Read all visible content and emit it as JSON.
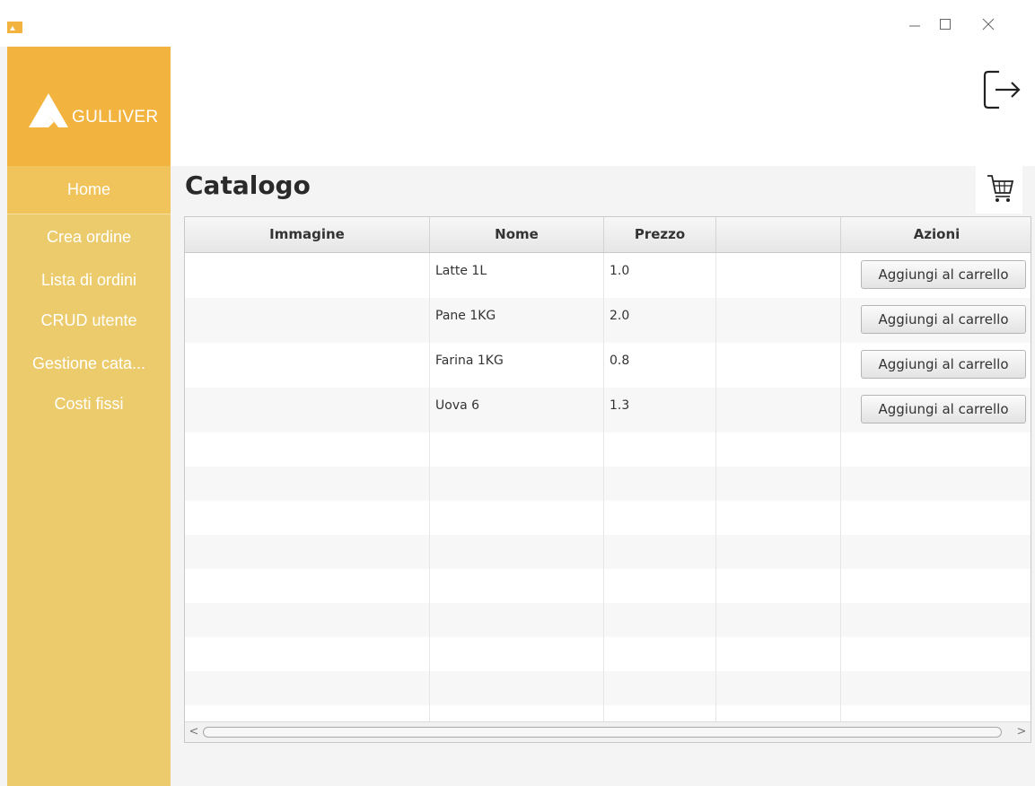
{
  "app": {
    "logo_text": "GULLIVER",
    "brand_color": "#f2b33f",
    "sidebar_color": "#ebcb6b"
  },
  "window_controls": {
    "minimize_icon": "minimize-icon",
    "maximize_icon": "maximize-icon",
    "close_icon": "close-icon"
  },
  "header": {
    "logout_icon": "logout-icon"
  },
  "sidebar": {
    "items": [
      {
        "label": "Home",
        "active": true
      },
      {
        "label": "Crea ordine",
        "active": false
      },
      {
        "label": "Lista di ordini",
        "active": false
      },
      {
        "label": "CRUD utente",
        "active": false
      },
      {
        "label": "Gestione cata...",
        "active": false
      },
      {
        "label": "Costi fissi",
        "active": false
      }
    ]
  },
  "main": {
    "title": "Catalogo",
    "cart_icon": "cart-icon"
  },
  "table": {
    "columns": [
      "Immagine",
      "Nome",
      "Prezzo",
      "",
      "Azioni"
    ],
    "rows": [
      {
        "immagine": "",
        "nome": "Latte 1L",
        "prezzo": "1.0",
        "extra": "",
        "action": "Aggiungi al carrello"
      },
      {
        "immagine": "",
        "nome": "Pane 1KG",
        "prezzo": "2.0",
        "extra": "",
        "action": "Aggiungi al carrello"
      },
      {
        "immagine": "",
        "nome": "Farina 1KG",
        "prezzo": "0.8",
        "extra": "",
        "action": "Aggiungi al carrello"
      },
      {
        "immagine": "",
        "nome": "Uova 6",
        "prezzo": "1.3",
        "extra": "",
        "action": "Aggiungi al carrello"
      }
    ],
    "scroll_left_glyph": "<",
    "scroll_right_glyph": ">"
  }
}
